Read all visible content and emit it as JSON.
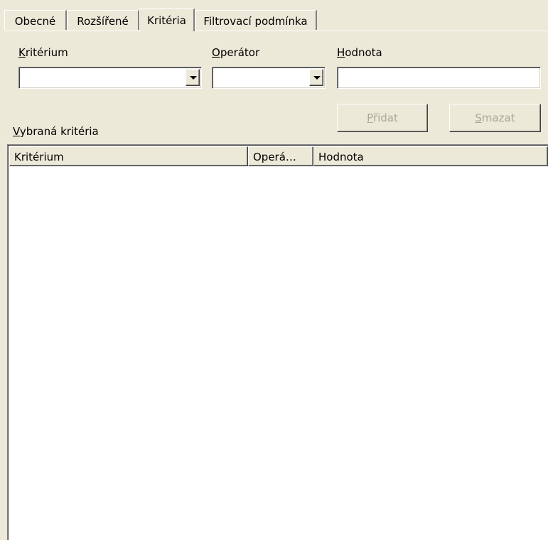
{
  "tabs": [
    {
      "label": "Obecné"
    },
    {
      "label": "Rozšířené"
    },
    {
      "label": "Kritéria"
    },
    {
      "label": "Filtrovací podmínka"
    }
  ],
  "active_tab": "Kritéria",
  "fields": {
    "criterion": {
      "label_first": "K",
      "label_rest": "ritérium",
      "value": ""
    },
    "operator": {
      "label_first": "O",
      "label_rest": "perátor",
      "value": ""
    },
    "value": {
      "label_first": "H",
      "label_rest": "odnota",
      "value": ""
    }
  },
  "buttons": {
    "add": {
      "first": "P",
      "rest": "řidat"
    },
    "delete": {
      "first": "S",
      "rest": "mazat"
    }
  },
  "selected_label": {
    "first": "V",
    "rest": "ybraná kritéria"
  },
  "list": {
    "columns": [
      "Kritérium",
      "Operá…",
      "Hodnota"
    ]
  },
  "icons": {
    "dropdown": "chevron-down-icon"
  }
}
